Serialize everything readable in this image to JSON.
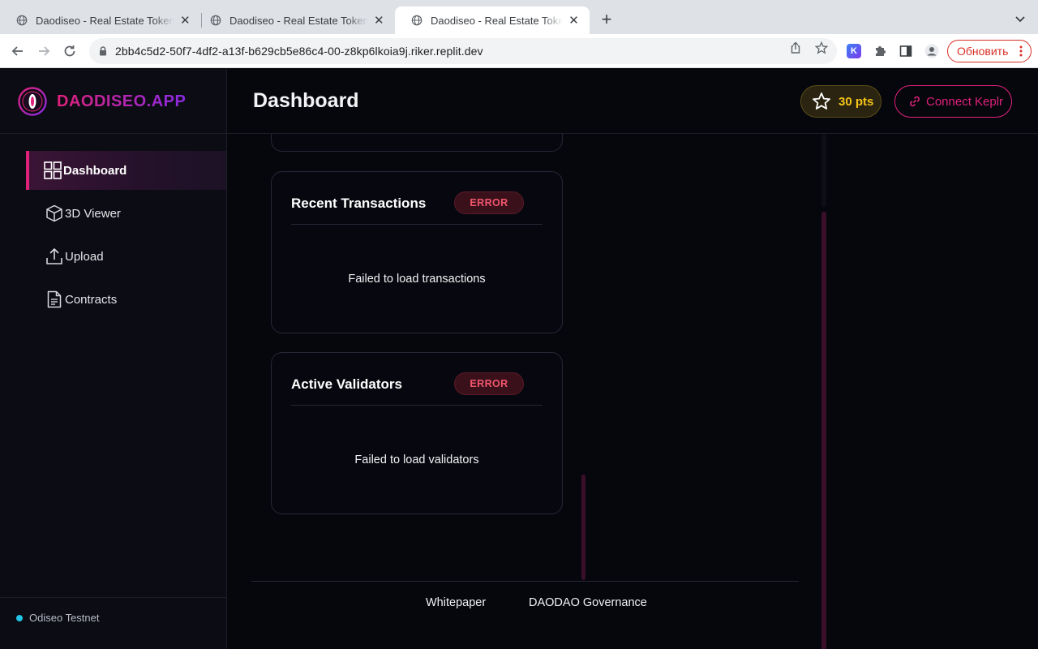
{
  "browser": {
    "tabs": [
      {
        "title": "Daodiseo - Real Estate Tokenization",
        "active": false
      },
      {
        "title": "Daodiseo - Real Estate Tokenization",
        "active": false
      },
      {
        "title": "Daodiseo - Real Estate Tokenization",
        "active": true
      }
    ],
    "url": "2bb4c5d2-50f7-4df2-a13f-b629cb5e86c4-00-z8kp6lkoia9j.riker.replit.dev",
    "update_button": "Обновить",
    "extension_letter": "K"
  },
  "app": {
    "brand": "DAODISEO.APP",
    "sidebar": {
      "items": [
        {
          "label": "Dashboard",
          "icon": "grid-icon",
          "active": true
        },
        {
          "label": "3D Viewer",
          "icon": "cube-icon",
          "active": false
        },
        {
          "label": "Upload",
          "icon": "upload-icon",
          "active": false
        },
        {
          "label": "Contracts",
          "icon": "document-icon",
          "active": false
        }
      ],
      "network": "Odiseo Testnet"
    },
    "header": {
      "title": "Dashboard",
      "points": "30 pts",
      "connect": "Connect Keplr"
    },
    "cards": [
      {
        "title": "Recent Transactions",
        "status": "ERROR",
        "message": "Failed to load transactions"
      },
      {
        "title": "Active Validators",
        "status": "ERROR",
        "message": "Failed to load validators"
      }
    ],
    "footer": {
      "links": [
        "Whitepaper",
        "DAODAO Governance"
      ]
    }
  },
  "colors": {
    "accent": "#e0217a",
    "accent_secondary": "#8a2be2",
    "points": "#f5c518",
    "error": "#f0566c",
    "network_dot": "#22c3e6",
    "background": "#06070d"
  }
}
